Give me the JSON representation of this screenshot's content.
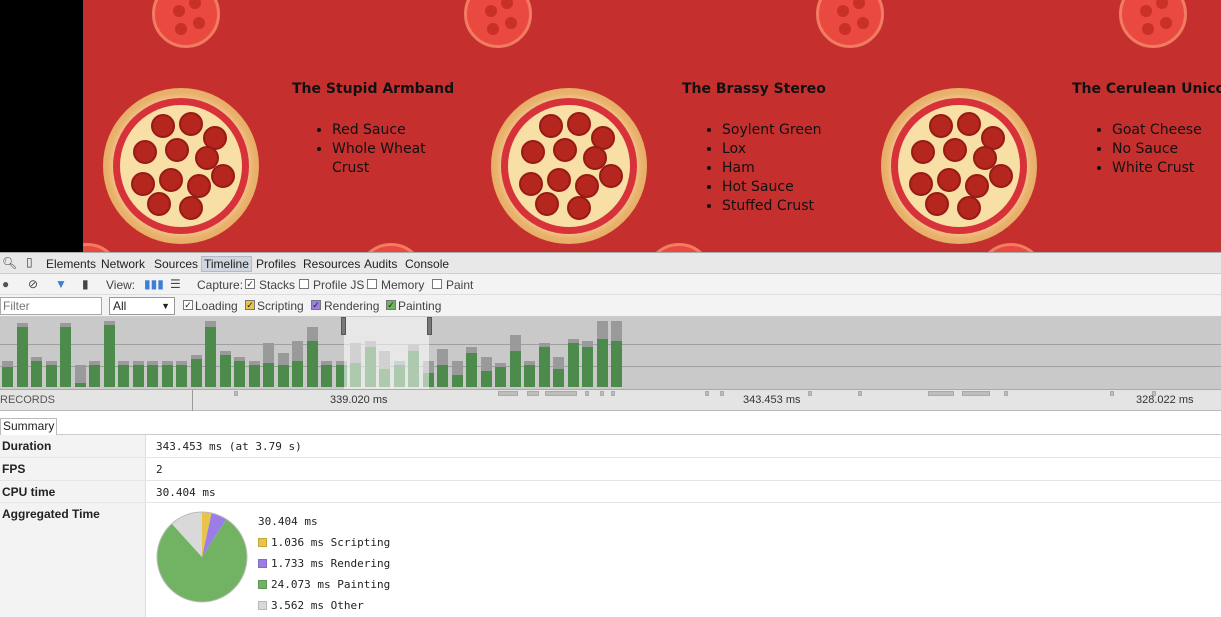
{
  "pizzas": [
    {
      "name": "The Stupid Armband",
      "toppings": [
        "Red Sauce",
        "Whole Wheat",
        "Crust"
      ]
    },
    {
      "name": "The Brassy Stereo",
      "toppings": [
        "Soylent Green",
        "Lox",
        "Ham",
        "Hot Sauce",
        "Stuffed Crust"
      ]
    },
    {
      "name": "The Cerulean Unico",
      "toppings": [
        "Goat Cheese",
        "No Sauce",
        "White Crust"
      ]
    }
  ],
  "devtools": {
    "tabs": [
      "Elements",
      "Network",
      "Sources",
      "Timeline",
      "Profiles",
      "Resources",
      "Audits",
      "Console"
    ],
    "active_tab": "Timeline",
    "timeline_toolbar": {
      "view_label": "View:",
      "capture_label": "Capture:",
      "capture_options": [
        {
          "label": "Stacks",
          "checked": true
        },
        {
          "label": "Profile JS",
          "checked": false
        },
        {
          "label": "Memory",
          "checked": false
        },
        {
          "label": "Paint",
          "checked": false
        }
      ]
    },
    "filter_toolbar": {
      "filter_placeholder": "Filter",
      "type_select_value": "All",
      "categories": [
        {
          "label": "Loading",
          "checked": true,
          "color": "#5b8fd6"
        },
        {
          "label": "Scripting",
          "checked": true,
          "color": "#e8c54a"
        },
        {
          "label": "Rendering",
          "checked": true,
          "color": "#9a7ee6"
        },
        {
          "label": "Painting",
          "checked": true,
          "color": "#71b363"
        }
      ]
    },
    "records_label": "RECORDS",
    "frame_times": [
      "339.020 ms",
      "343.453 ms",
      "328.022 ms"
    ],
    "summary": {
      "tab_label": "Summary",
      "rows": [
        {
          "key": "Duration",
          "value": "343.453 ms (at 3.79 s)"
        },
        {
          "key": "FPS",
          "value": "2"
        },
        {
          "key": "CPU time",
          "value": "30.404 ms"
        }
      ],
      "aggregated": {
        "label": "Aggregated Time",
        "total": "30.404 ms",
        "segments": [
          {
            "label": "1.036 ms Scripting",
            "value": 1.036,
            "color": "#e8c54a"
          },
          {
            "label": "1.733 ms Rendering",
            "value": 1.733,
            "color": "#9a7ee6"
          },
          {
            "label": "24.073 ms Painting",
            "value": 24.073,
            "color": "#71b363"
          },
          {
            "label": "3.562 ms Other",
            "value": 3.562,
            "color": "#d9d9d9"
          }
        ]
      }
    }
  }
}
